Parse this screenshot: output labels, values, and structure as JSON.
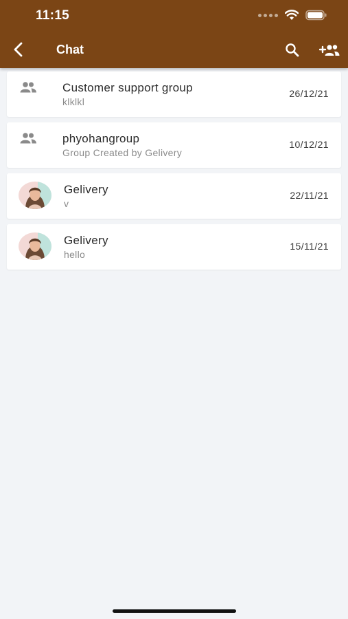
{
  "status_bar": {
    "time": "11:15"
  },
  "app_bar": {
    "title": "Chat",
    "color": "#7b4515",
    "back_icon": "chevron-left-icon",
    "search_icon": "search-icon",
    "add_user_icon": "group-add-icon"
  },
  "chats": [
    {
      "name": "Customer support group",
      "preview": "klklkl",
      "date": "26/12/21",
      "icon": "group-icon"
    },
    {
      "name": "phyohangroup",
      "preview": "Group Created by Gelivery",
      "date": "10/12/21",
      "icon": "group-icon"
    },
    {
      "name": "Gelivery",
      "preview": "v",
      "date": "22/11/21",
      "icon": "avatar"
    },
    {
      "name": "Gelivery",
      "preview": "hello",
      "date": "15/11/21",
      "icon": "avatar"
    }
  ]
}
